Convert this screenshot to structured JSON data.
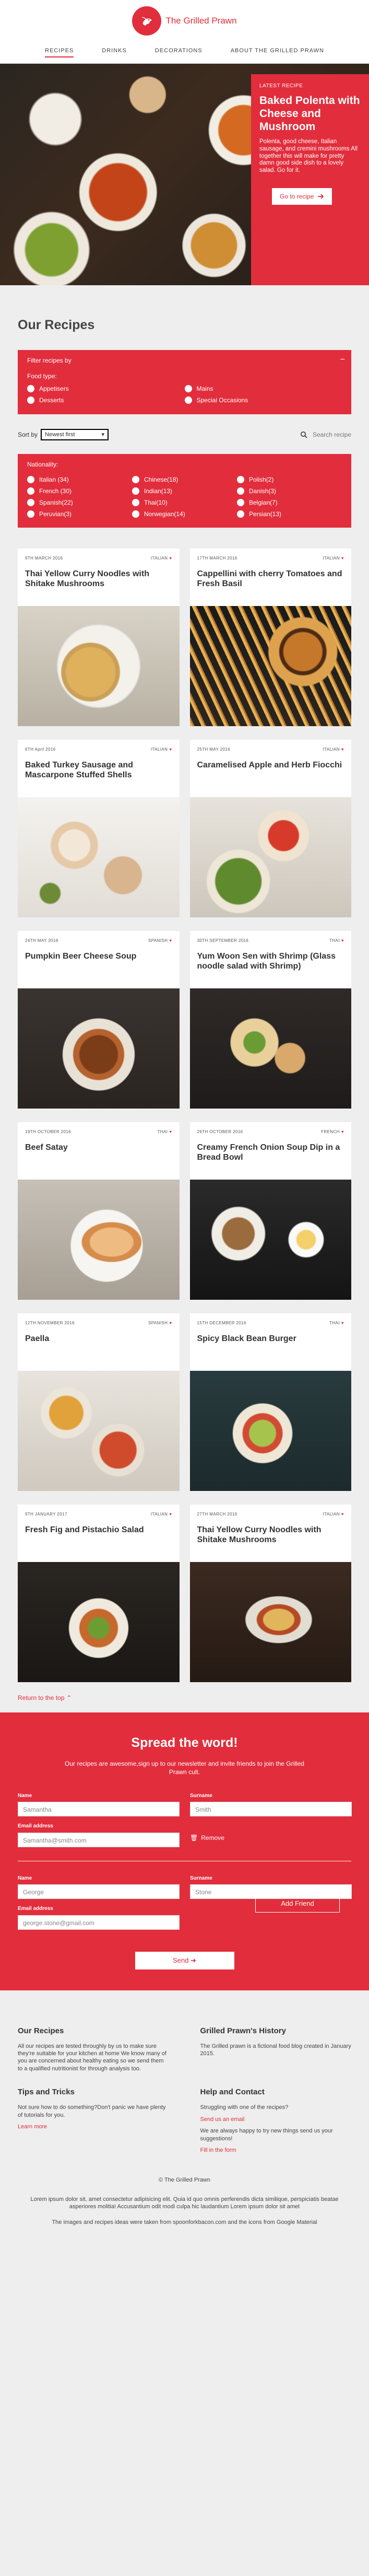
{
  "header": {
    "site_name": "The Grilled Prawn",
    "nav": [
      "RECIPES",
      "DRINKS",
      "DECORATIONS",
      "ABOUT THE GRILLED PRAWN"
    ]
  },
  "hero": {
    "kicker": "LATEST RECIPE",
    "title": "Baked Polenta with Cheese and Mushroom",
    "description": "Polenta, good cheese, Italian sausage, and cremini mushrooms All together this will make for pretty damn good side dish to a lovely salad. Go for it.",
    "button_label": "Go to recipe",
    "button_icon": "arrow-right-icon"
  },
  "recipes_section": {
    "title": "Our Recipes"
  },
  "filters": {
    "heading": "Filter recipes by",
    "collapse_symbol": "−",
    "food_type_label": "Food type:",
    "food_types": [
      "Appetisers",
      "Mains",
      "Desserts",
      "Special Occasions"
    ],
    "nationality_label": "Nationality:",
    "nationalities": [
      "Italian (34)",
      "Chinese(18)",
      "Polish(2)",
      "French (30)",
      "Indian(13)",
      "Danish(3)",
      "Spanish(22)",
      "Thai(10)",
      "Belgian(7)",
      "Peruvian(3)",
      "Norwegian(14)",
      "Persian(13)"
    ]
  },
  "sort": {
    "label": "Sort by",
    "value": "Newest first",
    "search_placeholder": "Search recipe"
  },
  "recipes": [
    {
      "date": "9TH MARCH 2016",
      "nationality": "ITALIAN",
      "title": "Thai Yellow Curry Noodles with Shitake Mushrooms"
    },
    {
      "date": "17TH MARCH 2016",
      "nationality": "ITALIAN",
      "title": "Cappellini with cherry Tomatoes and Fresh Basil"
    },
    {
      "date": "6TH April 2016",
      "nationality": "ITALIAN",
      "title": "Baked Turkey Sausage and Mascarpone Stuffed Shells"
    },
    {
      "date": "25TH MAY 2016",
      "nationality": "ITALIAN",
      "title": "Caramelised Apple and Herb Fiocchi"
    },
    {
      "date": "24TH MAY 2016",
      "nationality": "SPANISH",
      "title": "Pumpkin Beer Cheese Soup"
    },
    {
      "date": "30TH SEPTEMBER 2016",
      "nationality": "THAI",
      "title": "Yum Woon Sen with Shrimp (Glass noodle salad with Shrimp)"
    },
    {
      "date": "19TH OCTOBER 2016",
      "nationality": "THAI",
      "title": "Beef Satay"
    },
    {
      "date": "26TH OCTOBER 2016",
      "nationality": "FRENCH",
      "title": "Creamy French Onion Soup Dip in a Bread Bowl"
    },
    {
      "date": "12TH NOVEMBER 2016",
      "nationality": "SPANISH",
      "title": "Paella"
    },
    {
      "date": "15TH DECEMBER 2016",
      "nationality": "THAI",
      "title": "Spicy Black Bean Burger"
    },
    {
      "date": "9TH JANUARY 2017",
      "nationality": "ITALIAN",
      "title": "Fresh Fig and Pistachio Salad"
    },
    {
      "date": "27TH MARCH 2016",
      "nationality": "ITALIAN",
      "title": "Thai Yellow Curry Noodles with Shitake Mushrooms"
    }
  ],
  "back_to_top": "Return to the top",
  "newsletter": {
    "title": "Spread the word!",
    "description": "Our recipes are awesome,sign up to our newsletter and invite friends to join the Grilled Prawn cult.",
    "name_label": "Name",
    "surname_label": "Surname",
    "email_label": "Email address",
    "first_name": "Samantha",
    "first_surname": "Smith",
    "first_email": "Samantha@smith.com",
    "remove_label": "Remove",
    "second_name": "George",
    "second_surname": "Stone",
    "second_email": "george.stone@gmail.com",
    "add_friend_label": "Add Friend",
    "send_label": "Send",
    "send_icon": "arrow-right-icon"
  },
  "footer": {
    "our_recipes_title": "Our Recipes",
    "our_recipes_text": "All our recipes are tested throughly by us to make sure they're suitable for your kitchen at home We know many of you are concerned about healthy eating so we send them to a qualified nutritionist for through analysis too.",
    "history_title": "Grilled Prawn's History",
    "history_text": "The Grilled prawn is a fictional food blog created in January 2015.",
    "tips_title": "Tips and Tricks",
    "tips_text": "Not sure how to do something?Don't panic we have plenty of tutorials for you.",
    "learn_more": "Learn more",
    "help_title": "Help and Contact",
    "help_text": "Struggling with one of the recipes?",
    "send_email": "Send us an email",
    "suggestion_text": "We are always happy to try new things send us your suggestions!",
    "fill_form": "Fill in the form",
    "copyright": "© The Grilled Prawn",
    "lorem": "Lorem ipsum dolor sit, amet consectetur adipisicing elit. Quia id quo omnis perferendis dicta similique, perspiciatis beatae asperiores molitia! Accusantium odit modi culpa hic laudantium Lorem ipsum dolor sit amet",
    "credits": "The images and recipes ideas were taken from spoonforkbacon.com and the icons from Google Material"
  },
  "colors": {
    "brand_red": "#e22d3c",
    "page_bg": "#eeeeee"
  }
}
